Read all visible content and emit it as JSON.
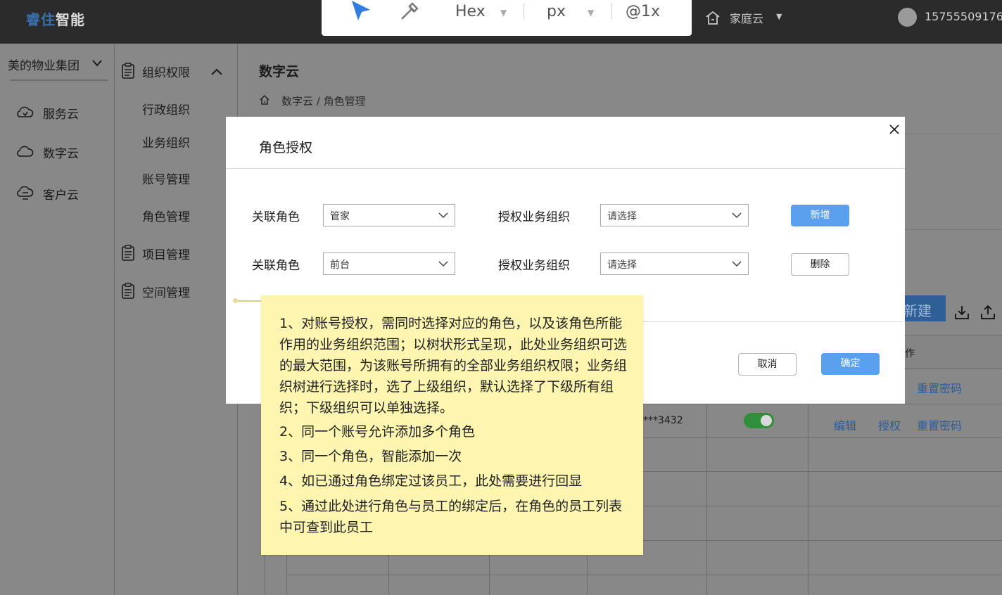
{
  "topbar": {
    "logo_a": "睿住",
    "logo_b": "智能",
    "tool_format": "Hex",
    "tool_unit": "px",
    "tool_scale": "@1x",
    "cloud_label": "家庭云",
    "user_phone": "15755509176"
  },
  "sidebar": {
    "group": "美的物业集团",
    "items": [
      {
        "label": "服务云",
        "icon": "cloud-icon"
      },
      {
        "label": "数字云",
        "icon": "cloud-icon"
      },
      {
        "label": "客户云",
        "icon": "cloud-chat-icon"
      }
    ]
  },
  "subnav": {
    "section1": "组织权限",
    "sub_items": [
      "行政组织",
      "业务组织",
      "账号管理",
      "角色管理"
    ],
    "section2": "项目管理",
    "section3": "空间管理"
  },
  "main": {
    "title": "数字云",
    "breadcrumb": "数字云 / 角色管理",
    "new_button": "新建",
    "column_header": "作",
    "phone": "***3432",
    "action_reset": "重置密码",
    "action_edit": "编辑",
    "action_grant": "授权"
  },
  "modal": {
    "title": "角色授权",
    "rows": [
      {
        "role_label": "关联角色",
        "role_value": "管家",
        "org_label": "授权业务组织",
        "org_value": "请选择",
        "action": "新增"
      },
      {
        "role_label": "关联角色",
        "role_value": "前台",
        "org_label": "授权业务组织",
        "org_value": "请选择",
        "action": "删除"
      }
    ],
    "cancel": "取消",
    "confirm": "确定"
  },
  "note": {
    "p1": "1、对账号授权，需同时选择对应的角色，以及该角色所能作用的业务组织范围；以树状形式呈现，此处业务组织可选的最大范围，为该账号所拥有的全部业务组织权限；业务组织树进行选择时，选了上级组织，默认选择了下级所有组织；下级组织可以单独选择。",
    "p2": "2、同一个账号允许添加多个角色",
    "p3": "3、同一个角色，智能添加一次",
    "p4": "4、如已通过角色绑定过该员工，此处需要进行回显",
    "p5": "5、通过此处进行角色与员工的绑定后，在角色的员工列表中可查到此员工"
  },
  "colors": {
    "primary": "#5aa0ee",
    "topbar": "#2b2b2b",
    "overlay": "#888888",
    "note": "#fef5b0",
    "toggle_on": "#2f8f3a"
  }
}
